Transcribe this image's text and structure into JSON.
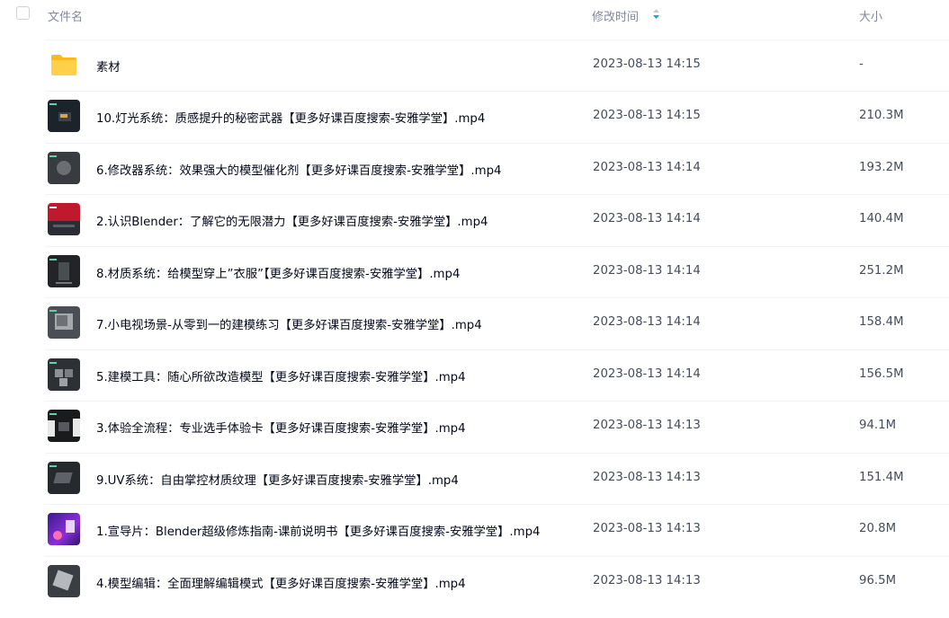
{
  "header": {
    "name_label": "文件名",
    "time_label": "修改时间",
    "size_label": "大小"
  },
  "files": [
    {
      "name": "素材",
      "time": "2023-08-13 14:15",
      "size": "-",
      "icon": "folder-icon"
    },
    {
      "name": "10.灯光系统：质感提升的秘密武器【更多好课百度搜索-安雅学堂】.mp4",
      "time": "2023-08-13 14:15",
      "size": "210.3M",
      "icon": "video-thumbnail"
    },
    {
      "name": "6.修改器系统：效果强大的模型催化剂【更多好课百度搜索-安雅学堂】.mp4",
      "time": "2023-08-13 14:14",
      "size": "193.2M",
      "icon": "video-thumbnail"
    },
    {
      "name": "2.认识Blender：了解它的无限潜力【更多好课百度搜索-安雅学堂】.mp4",
      "time": "2023-08-13 14:14",
      "size": "140.4M",
      "icon": "video-thumbnail"
    },
    {
      "name": "8.材质系统：给模型穿上”衣服”【更多好课百度搜索-安雅学堂】.mp4",
      "time": "2023-08-13 14:14",
      "size": "251.2M",
      "icon": "video-thumbnail"
    },
    {
      "name": "7.小电视场景-从零到一的建模练习【更多好课百度搜索-安雅学堂】.mp4",
      "time": "2023-08-13 14:14",
      "size": "158.4M",
      "icon": "video-thumbnail"
    },
    {
      "name": "5.建模工具：随心所欲改造模型【更多好课百度搜索-安雅学堂】.mp4",
      "time": "2023-08-13 14:14",
      "size": "156.5M",
      "icon": "video-thumbnail"
    },
    {
      "name": "3.体验全流程：专业选手体验卡【更多好课百度搜索-安雅学堂】.mp4",
      "time": "2023-08-13 14:13",
      "size": "94.1M",
      "icon": "video-thumbnail"
    },
    {
      "name": "9.UV系统：自由掌控材质纹理【更多好课百度搜索-安雅学堂】.mp4",
      "time": "2023-08-13 14:13",
      "size": "151.4M",
      "icon": "video-thumbnail"
    },
    {
      "name": "1.宣导片：Blender超级修炼指南-课前说明书【更多好课百度搜索-安雅学堂】.mp4",
      "time": "2023-08-13 14:13",
      "size": "20.8M",
      "icon": "video-thumbnail"
    },
    {
      "name": "4.模型编辑：全面理解编辑模式【更多好课百度搜索-安雅学堂】.mp4",
      "time": "2023-08-13 14:13",
      "size": "96.5M",
      "icon": "video-thumbnail"
    }
  ],
  "colors": {
    "header_text": "#818999",
    "name_text": "#03081a",
    "meta_text": "#454d5a",
    "folder": "#ffc53d",
    "sort_active": "#06a7ff"
  }
}
